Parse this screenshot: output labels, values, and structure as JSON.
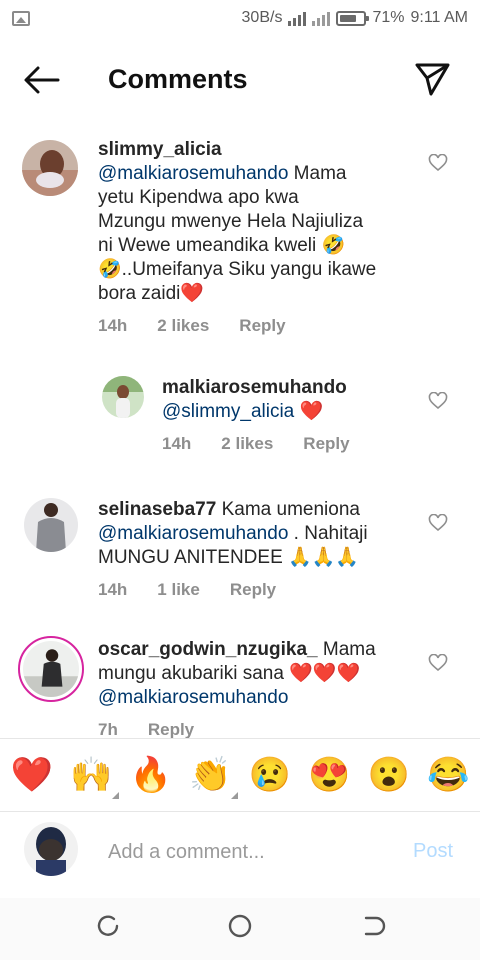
{
  "status_bar": {
    "network_speed": "30B/s",
    "battery_percent": "71%",
    "time": "9:11 AM",
    "battery_level": 0.71
  },
  "header": {
    "title": "Comments",
    "back_icon": "arrow-left-icon",
    "share_icon": "paper-plane-icon"
  },
  "comments": [
    {
      "username": "slimmy_alicia",
      "mention": "@malkiarosemuhando",
      "text_line1": " Mama",
      "text_line2": "yetu Kipendwa apo kwa",
      "text_line3": "Mzungu mwenye Hela Najiuliza",
      "text_line4": "ni Wewe umeandika kweli 🤣",
      "text_line5": "🤣..Umeifanya Siku yangu ikawe",
      "text_line6": "bora zaidi❤️",
      "time": "14h",
      "likes": "2 likes",
      "reply_label": "Reply"
    },
    {
      "username": "malkiarosemuhando",
      "mention": "@slimmy_alicia",
      "text": " ❤️",
      "time": "14h",
      "likes": "2 likes",
      "reply_label": "Reply"
    },
    {
      "username": "selinaseba77",
      "text_line1": " Kama umeniona",
      "mention": "@malkiarosemuhando",
      "text_line2": " . Nahitaji",
      "text_line3": "MUNGU ANITENDEE 🙏🙏🙏",
      "time": "14h",
      "likes": "1 like",
      "reply_label": "Reply"
    },
    {
      "username": "oscar_godwin_nzugika_",
      "text_line1": " Mama",
      "text_line2": "mungu akubariki sana ❤️❤️❤️",
      "mention": "@malkiarosemuhando",
      "time": "7h",
      "reply_label": "Reply"
    }
  ],
  "emoji_bar": [
    "❤️",
    "🙌",
    "🔥",
    "👏",
    "😢",
    "😍",
    "😮",
    "😂"
  ],
  "composer": {
    "placeholder": "Add a comment...",
    "post_label": "Post"
  },
  "colors": {
    "mention": "#00376b",
    "meta": "#8e8e8e",
    "post_disabled": "#b3dbff",
    "story_ring": "#d6249f"
  }
}
